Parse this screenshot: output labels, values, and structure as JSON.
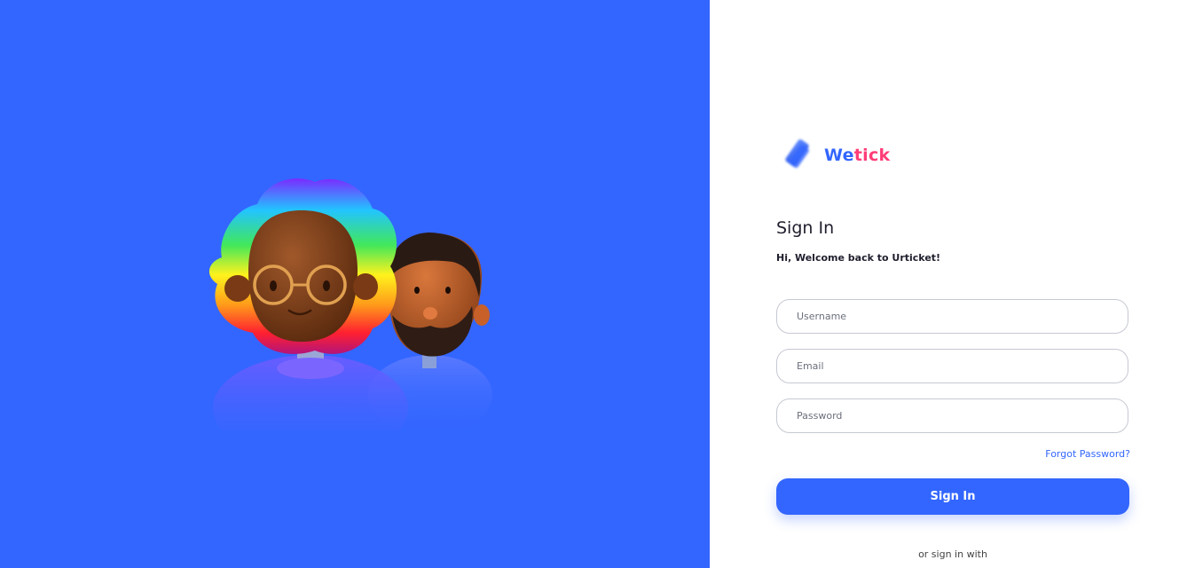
{
  "brand": {
    "logo_text_part1": "We",
    "logo_text_part2": "tick",
    "primary_color": "#3366ff",
    "accent_color": "#ff3d77"
  },
  "signin": {
    "title": "Sign In",
    "subtitle": "Hi, Welcome back to Urticket!",
    "username_placeholder": "Username",
    "email_placeholder": "Email",
    "password_placeholder": "Password",
    "forgot_password": "Forgot Password?",
    "submit_label": "Sign In",
    "alt_signin_text": "or sign in with"
  },
  "illustration": {
    "icon": "avatars-illustration"
  }
}
